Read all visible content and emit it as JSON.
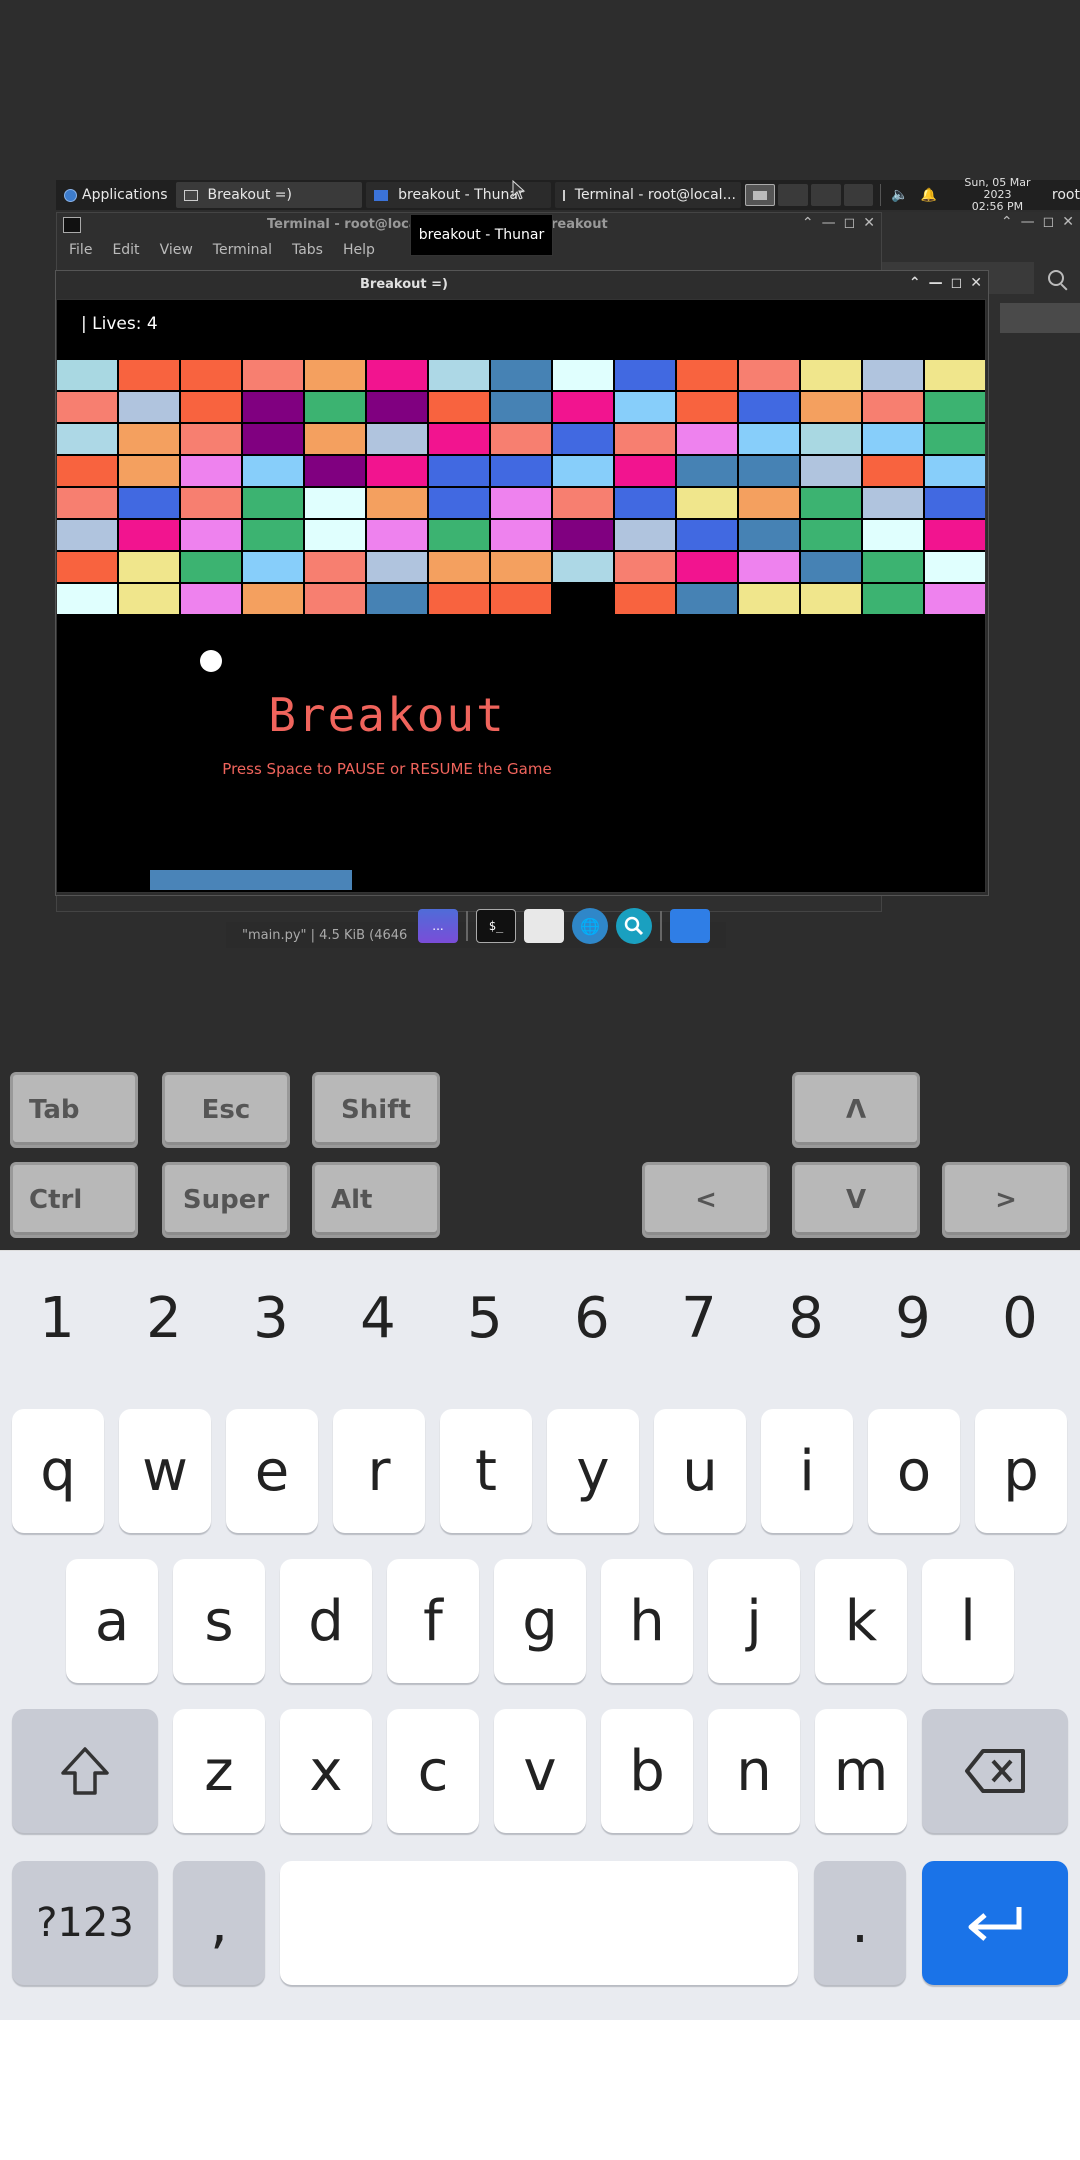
{
  "taskbar": {
    "applications": "Applications",
    "tasks": [
      "Breakout =)",
      "breakout - Thunar",
      "Terminal - root@local..."
    ],
    "clock_date": "Sun, 05 Mar 2023",
    "clock_time": "02:56 PM",
    "user": "root"
  },
  "terminal": {
    "title_start": "Terminal - root@locall",
    "title_end": "reakout",
    "menu": [
      "File",
      "Edit",
      "View",
      "Terminal",
      "Tabs",
      "Help"
    ]
  },
  "tooltip": "breakout - Thunar",
  "thunar_status": "\"main.py\"  |  4.5 KiB (4646",
  "breakout_window": {
    "title": "Breakout =)",
    "lives": "| Lives: 4",
    "game_title": "Breakout",
    "hint": "Press Space to PAUSE or RESUME the Game"
  },
  "brick_grid": {
    "columns": 15,
    "rows": [
      [
        "#a9d8e2",
        "#f8633f",
        "#f8633f",
        "#f77f70",
        "#f4a05f",
        "#f2148f",
        "#add8e6",
        "#4682b4",
        "#e0fffe",
        "#4169e1",
        "#f8633f",
        "#f77f70",
        "#f0e68c",
        "#b0c4de",
        "#f0e68c"
      ],
      [
        "#f77f70",
        "#b0c4de",
        "#f8633f",
        "#800080",
        "#3cb371",
        "#800080",
        "#f8633f",
        "#4682b4",
        "#f2148f",
        "#87cefa",
        "#f8633f",
        "#4169e1",
        "#f4a05f",
        "#f77f70",
        "#3cb371"
      ],
      [
        "#add8e6",
        "#f4a05f",
        "#f77f70",
        "#800080",
        "#f4a05f",
        "#b0c4de",
        "#f2148f",
        "#f77f70",
        "#4169e1",
        "#f77f70",
        "#ee82ee",
        "#87cefa",
        "#a9d8e2",
        "#87cefa",
        "#3cb371"
      ],
      [
        "#f8633f",
        "#f4a05f",
        "#ee82ee",
        "#87cefa",
        "#800080",
        "#f2148f",
        "#4169e1",
        "#4169e1",
        "#87cefa",
        "#f2148f",
        "#4682b4",
        "#4682b4",
        "#b0c4de",
        "#f8633f",
        "#87cefa"
      ],
      [
        "#f77f70",
        "#4169e1",
        "#f77f70",
        "#3cb371",
        "#e0fffe",
        "#f4a05f",
        "#4169e1",
        "#ee82ee",
        "#f77f70",
        "#4169e1",
        "#f0e68c",
        "#f4a05f",
        "#3cb371",
        "#b0c4de",
        "#4169e1"
      ],
      [
        "#b0c4de",
        "#f2148f",
        "#ee82ee",
        "#3cb371",
        "#e0fffe",
        "#ee82ee",
        "#3cb371",
        "#ee82ee",
        "#800080",
        "#b0c4de",
        "#4169e1",
        "#4682b4",
        "#3cb371",
        "#e0fffe",
        "#f2148f"
      ],
      [
        "#f8633f",
        "#f0e68c",
        "#3cb371",
        "#87cefa",
        "#f77f70",
        "#b0c4de",
        "#f4a05f",
        "#f4a05f",
        "#add8e6",
        "#f77f70",
        "#f2148f",
        "#ee82ee",
        "#4682b4",
        "#3cb371",
        "#e0fffe"
      ],
      [
        "#e0fffe",
        "#f0e68c",
        "#ee82ee",
        "#f4a05f",
        "#f77f70",
        "#4682b4",
        "#f8633f",
        "#f8633f",
        null,
        "#f8633f",
        "#4682b4",
        "#f0e68c",
        "#f0e68c",
        "#3cb371",
        "#ee82ee"
      ]
    ]
  },
  "dock": {
    "show_label": "...",
    "terminal_label": "$_"
  },
  "extra_keys": {
    "tab": "Tab",
    "esc": "Esc",
    "shift": "Shift",
    "up": "Λ",
    "ctrl": "Ctrl",
    "super": "Super",
    "alt": "Alt",
    "left": "<",
    "down": "V",
    "right": ">"
  },
  "keyboard": {
    "numbers": [
      "1",
      "2",
      "3",
      "4",
      "5",
      "6",
      "7",
      "8",
      "9",
      "0"
    ],
    "row1": [
      "q",
      "w",
      "e",
      "r",
      "t",
      "y",
      "u",
      "i",
      "o",
      "p"
    ],
    "row2": [
      "a",
      "s",
      "d",
      "f",
      "g",
      "h",
      "j",
      "k",
      "l"
    ],
    "row3": [
      "z",
      "x",
      "c",
      "v",
      "b",
      "n",
      "m"
    ],
    "symbols": "?123",
    "comma": ",",
    "period": "."
  },
  "colors": {
    "accent": "#1a73e8",
    "game_text": "#f0645c",
    "paddle": "#4a84b8"
  }
}
